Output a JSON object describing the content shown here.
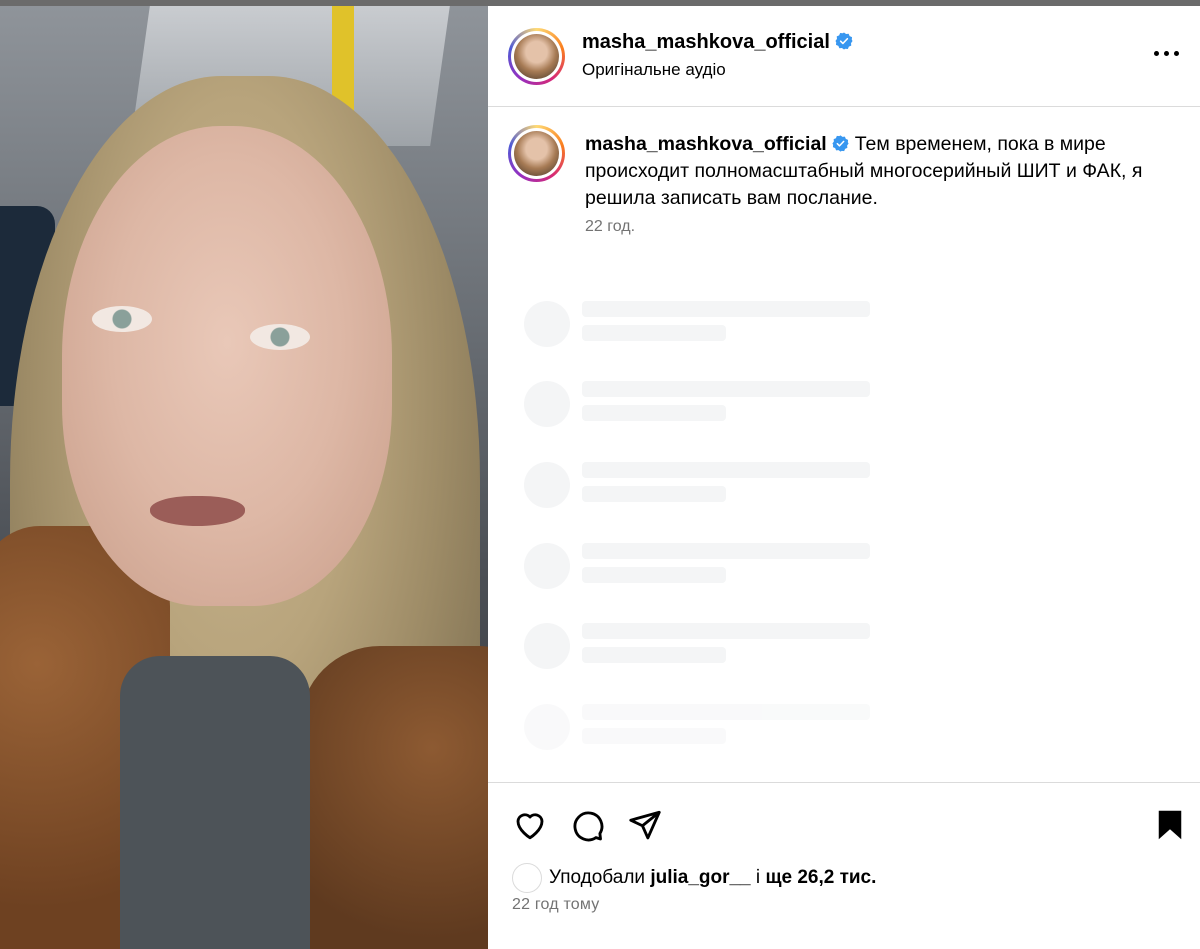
{
  "post": {
    "username": "masha_mashkova_official",
    "audio": "Оригінальне аудіо",
    "caption": "Тем временем, пока в мире происходит полномасштабный многосерийный ШИТ и ФАК, я решила записать вам послание.",
    "caption_time": "22 год.",
    "liked_by_prefix": "Уподобали",
    "liked_by_user": "julia_gor__",
    "liked_by_joiner": "і",
    "likes_count": "ще 26,2 тис.",
    "posted_ago": "22 год тому"
  },
  "icons": {
    "verified": "verified-badge-icon",
    "more": "more-options-icon",
    "like": "heart-icon",
    "comment": "comment-icon",
    "share": "share-icon",
    "save": "bookmark-icon"
  },
  "colors": {
    "verified_blue": "#3897f0",
    "muted_text": "#737373",
    "divider": "#dbdbdb",
    "skeleton": "#f4f5f6"
  }
}
